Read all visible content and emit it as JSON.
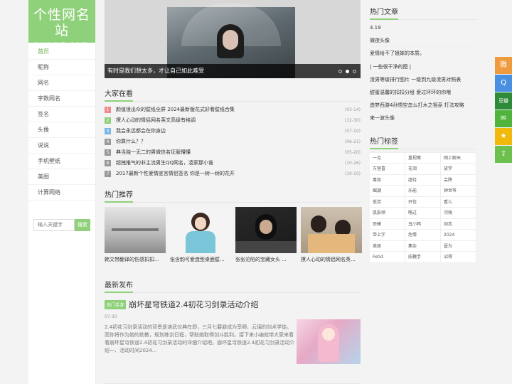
{
  "logo": {
    "main": "个性网名站",
    "sub": "gxwmz.com"
  },
  "nav": [
    "首页",
    "昵称",
    "网名",
    "字数网名",
    "签名",
    "头像",
    "说说",
    "手机壁纸",
    "美图",
    "计算网络"
  ],
  "search": {
    "placeholder": "输入关键字",
    "button": "搜索"
  },
  "slider": {
    "caption": "有时是我们想太多，才让自己如此难受"
  },
  "rank": {
    "title": "大家在看",
    "items": [
      {
        "num": "1",
        "title": "颜值很出众的壁纸全屏 2024最新版花式好看壁纸合集",
        "date": "(03-14)",
        "color": "#f08a8a"
      },
      {
        "num": "2",
        "title": "撩人心动的情侣网名英文高级有格调",
        "date": "(12-30)",
        "color": "#8fd17a"
      },
      {
        "num": "3",
        "title": "我会永远都会在你身边",
        "date": "(07-10)",
        "color": "#7ab8e8"
      },
      {
        "num": "4",
        "title": "你算什么？？",
        "date": "(06-21)",
        "color": "#999999"
      },
      {
        "num": "5",
        "title": "典当独一无二的男微信名征服懵懂",
        "date": "(05-20)",
        "color": "#999999"
      },
      {
        "num": "6",
        "title": "超拽推气的非主流男生QQ网名，凌家那小谁",
        "date": "(10-26)",
        "color": "#999999"
      },
      {
        "num": "7",
        "title": "2017最新个性爱情宣言情侣签名 你是一树一树的花开",
        "date": "(10-10)",
        "color": "#999999"
      }
    ]
  },
  "hot": {
    "title": "热门推荐",
    "items": [
      {
        "caption": "韩文带翻译的伤感扣扣..."
      },
      {
        "caption": "张含韵可爱造型桌面壁..."
      },
      {
        "caption": "张张沦陷的宝藏女头 ..."
      },
      {
        "caption": "撩人心动的情侣网名英..."
      }
    ]
  },
  "latest": {
    "title": "最新发布",
    "tag": "热门手游",
    "headline": "崩坏星穹铁道2.4初花习剑录活动介绍",
    "date": "07-30",
    "body": "2.4初花习剑录活动的背景是演武仪典在即，三月七要避成为孪卿、云璃的剑术学徒。而你将作为她的助教，规划练剑日程，帮助她取得剑斗胜利。接下来小编就带大家来看看崩坏星穹铁道2.4初花习剑录活动的详细介绍吧。崩坏星穹铁道2.4初花习剑录活动介绍一、活动时间2024..."
  },
  "right": {
    "articles_title": "热门文章",
    "articles": [
      "4.19",
      "微夜头像",
      "爱情给不了姐妹的本质。",
      "| 一些很干净的图 |",
      "渣男等级排行图片 一级到九级渣男对照表",
      "甜蜜温馨的扣扣分组 爱过环环的你哦",
      "造梦西游4孙悟空怎么打木之祖巫 打法攻略",
      "来一波头像"
    ],
    "tags_title": "热门标签",
    "tags": [
      "一见",
      "重视寓",
      "网上聊天",
      "万营喜",
      "花泪",
      "放学",
      "毒奴",
      "虐待",
      "会降",
      "崛潮",
      "乐能",
      "钟世爷",
      "低觉",
      "开信",
      "看么",
      "肌肤倾",
      "略过",
      "河殇",
      "恐睡",
      "丑小鸭",
      "如恋",
      "带上字",
      "危情",
      "2024",
      "美居",
      "集杂",
      "昼为",
      "Fetid",
      "庇鞭手",
      "诏得"
    ]
  },
  "social": [
    {
      "icon": "weibo-icon",
      "glyph": "微",
      "color": "#f09a3e"
    },
    {
      "icon": "qq-icon",
      "glyph": "Q",
      "color": "#4a90e2"
    },
    {
      "icon": "douban-icon",
      "glyph": "豆瓣",
      "color": "#2e8b3a"
    },
    {
      "icon": "wechat-icon",
      "glyph": "✉",
      "color": "#4fb33c"
    },
    {
      "icon": "star-icon",
      "glyph": "★",
      "color": "#f0b90b"
    },
    {
      "icon": "share-icon",
      "glyph": "⇪",
      "color": "#6dc04e"
    }
  ]
}
